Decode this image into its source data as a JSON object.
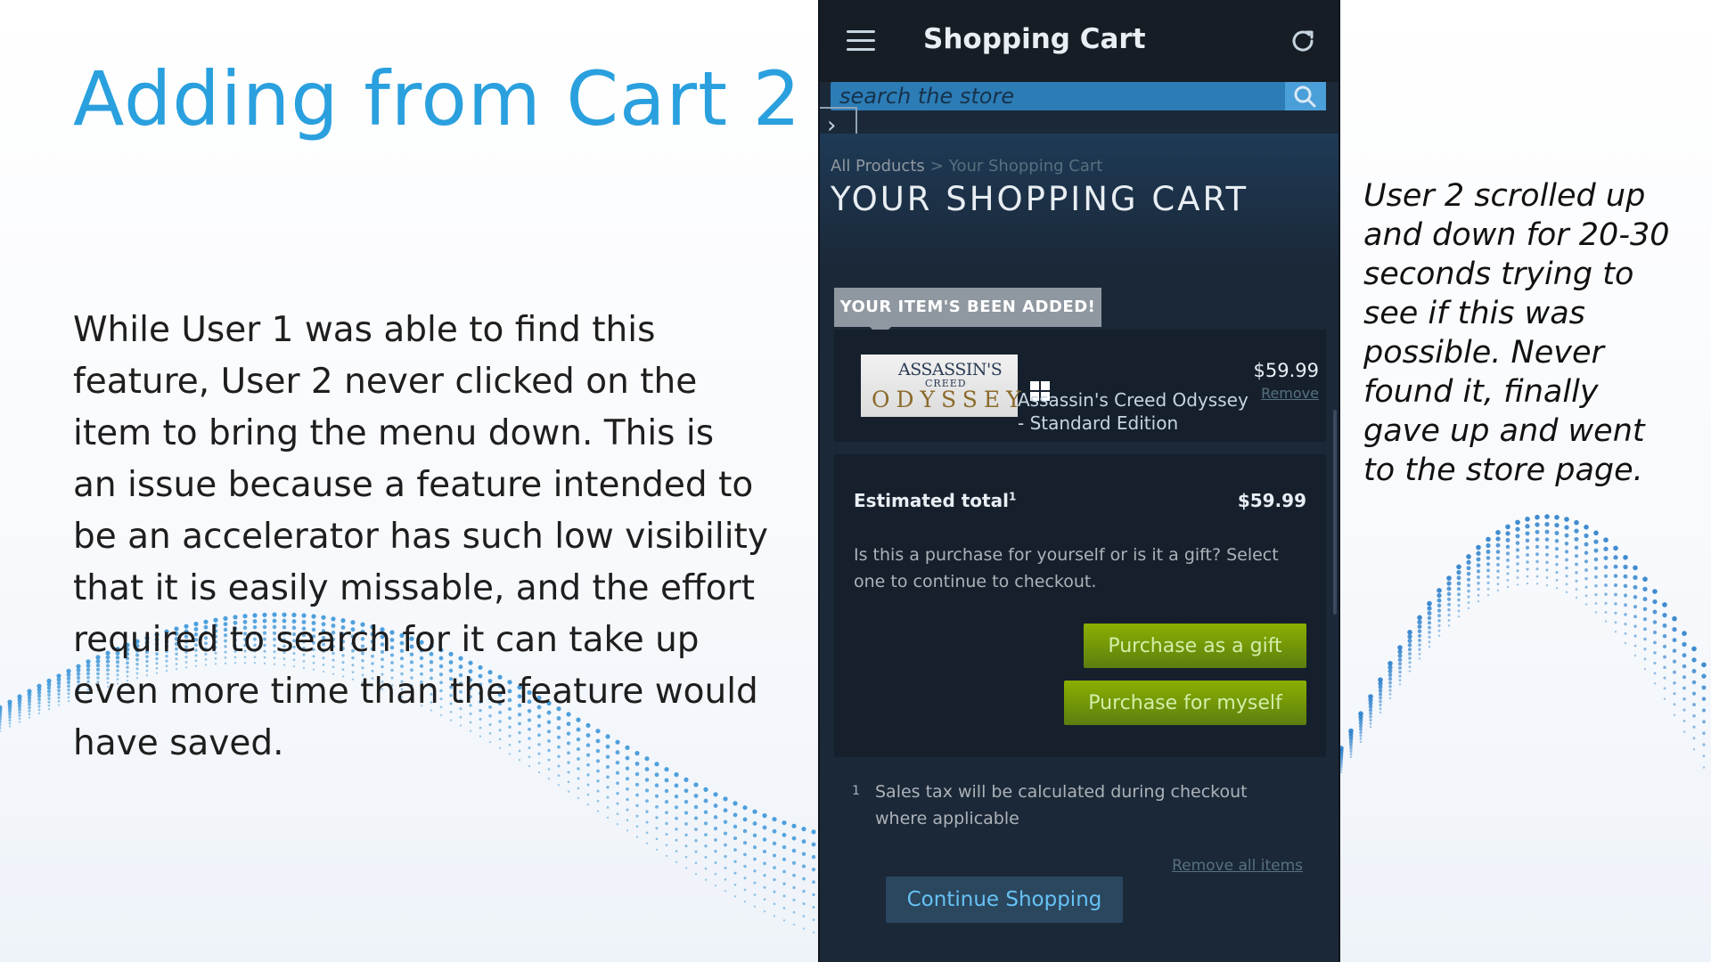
{
  "slide": {
    "title": "Adding from Cart 2",
    "body": "While User 1 was able to find this feature, User 2 never clicked on the item to bring the menu down. This is an issue because a feature intended to be an accelerator has such low visibility that it is easily missable, and the effort required to search for it can take up even more time than the feature would have saved.",
    "note": "User 2 scrolled up and down for 20-30 seconds trying to see if this was possible. Never found it, finally gave up and went to the store page."
  },
  "app": {
    "title": "Shopping Cart",
    "menu_icon": "hamburger-menu-icon",
    "refresh_icon": "refresh-icon",
    "search_placeholder": "search the store",
    "search_icon": "magnifier-icon"
  },
  "breadcrumb": {
    "link": "All Products",
    "separator": ">",
    "current": "Your Shopping Cart"
  },
  "page_heading": "YOUR SHOPPING CART",
  "added_badge": "YOUR ITEM'S BEEN ADDED!",
  "item": {
    "thumb_line1": "ASSASSIN'S",
    "thumb_line2": "CREED",
    "thumb_line3": "ODYSSEY",
    "name": "Assassin's Creed Odyssey - Standard Edition",
    "price": "$59.99",
    "remove_label": "Remove",
    "platform_icon": "windows-icon"
  },
  "total": {
    "label": "Estimated total",
    "footnote_ref": "1",
    "value": "$59.99",
    "question": "Is this a purchase for yourself or is it a gift? Select one to continue to checkout.",
    "gift_button": "Purchase as a gift",
    "myself_button": "Purchase for myself"
  },
  "footer": {
    "footnote_mark": "1",
    "footnote": "Sales tax will be calculated during checkout where applicable",
    "remove_all": "Remove all items",
    "continue_button": "Continue Shopping"
  },
  "colors": {
    "title_accent": "#2aa0de",
    "steam_bg": "#1b2838",
    "purchase_green": "#6f9a00",
    "continue_text": "#67c1f5"
  }
}
